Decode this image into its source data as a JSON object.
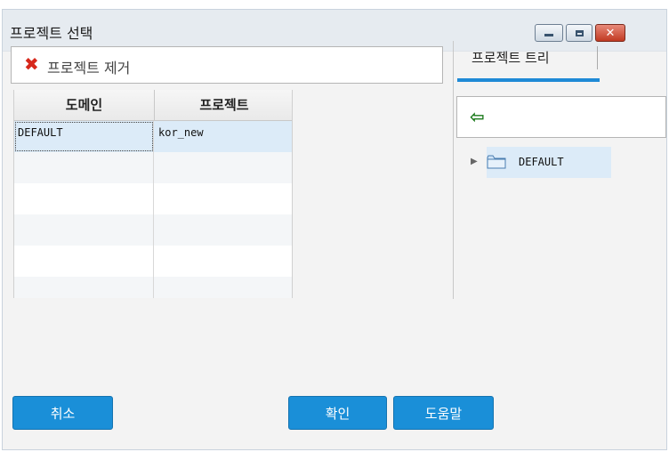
{
  "window": {
    "title": "프로젝트 선택",
    "controls": {
      "minimize": "minimize",
      "maximize": "maximize",
      "close": "✕"
    }
  },
  "toolbar": {
    "remove_project_label": "프로젝트 제거"
  },
  "grid": {
    "columns": [
      "도메인",
      "프로젝트"
    ],
    "rows": [
      {
        "domain": "DEFAULT",
        "project": "kor_new",
        "selected": true
      }
    ]
  },
  "tree_panel": {
    "tab_label": "프로젝트 트리",
    "items": [
      {
        "label": "DEFAULT"
      }
    ]
  },
  "buttons": {
    "cancel": "취소",
    "ok": "확인",
    "help": "도움말"
  },
  "colors": {
    "accent": "#1a8fd8",
    "selection": "#dcebf8",
    "remove_icon": "#d7281b",
    "back_arrow": "#1c7a1c"
  }
}
